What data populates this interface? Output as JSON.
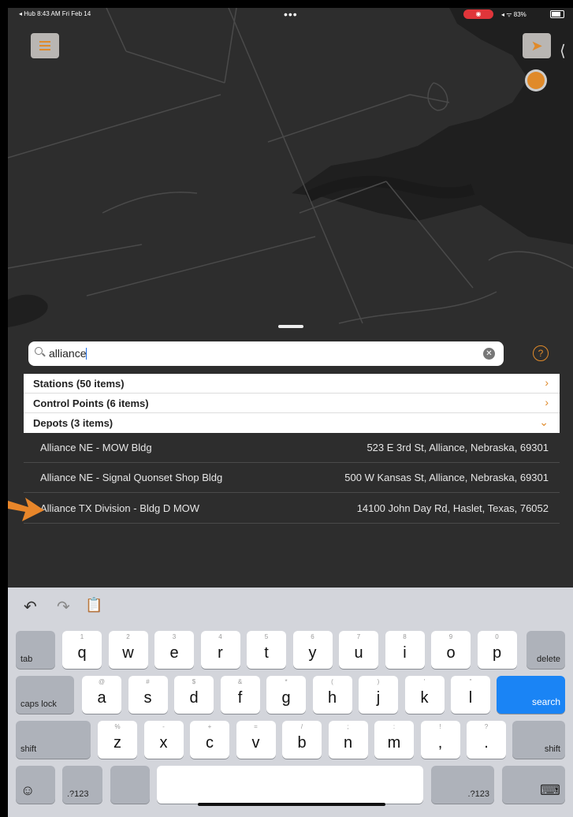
{
  "status_bar": {
    "left": "◂ Hub  8:43 AM  Fri Feb 14",
    "dots": "•••",
    "record": "◉",
    "right": "◂ ᯤ 83%"
  },
  "search": {
    "value": "alliance",
    "clear_label": "✕",
    "help_label": "?"
  },
  "categories": [
    {
      "label": "Stations  (50 items)",
      "chevron": "›",
      "expanded": false
    },
    {
      "label": "Control Points  (6 items)",
      "chevron": "›",
      "expanded": false
    },
    {
      "label": "Depots  (3 items)",
      "chevron": "⌄",
      "expanded": true
    }
  ],
  "results": [
    {
      "name": "Alliance NE - MOW Bldg",
      "address": "523 E 3rd St, Alliance, Nebraska, 69301"
    },
    {
      "name": "Alliance NE - Signal Quonset Shop Bldg",
      "address": "500 W Kansas St, Alliance, Nebraska, 69301"
    },
    {
      "name": "Alliance TX Division - Bldg D MOW",
      "address": "14100 John Day Rd, Haslet, Texas, 76052"
    }
  ],
  "keyboard": {
    "toolbar": {
      "undo": "↶",
      "redo": "↷",
      "paste": "📋"
    },
    "row1": {
      "tab": "tab",
      "keys": [
        [
          "1",
          "q"
        ],
        [
          "2",
          "w"
        ],
        [
          "3",
          "e"
        ],
        [
          "4",
          "r"
        ],
        [
          "5",
          "t"
        ],
        [
          "6",
          "y"
        ],
        [
          "7",
          "u"
        ],
        [
          "8",
          "i"
        ],
        [
          "9",
          "o"
        ],
        [
          "0",
          "p"
        ]
      ],
      "delete": "delete"
    },
    "row2": {
      "caps": "caps lock",
      "keys": [
        [
          "@",
          "a"
        ],
        [
          "#",
          "s"
        ],
        [
          "$",
          "d"
        ],
        [
          "&",
          "f"
        ],
        [
          "*",
          "g"
        ],
        [
          "(",
          "h"
        ],
        [
          ")",
          "j"
        ],
        [
          "'",
          "k"
        ],
        [
          "\"",
          "l"
        ]
      ],
      "search": "search"
    },
    "row3": {
      "shift_left": "shift",
      "keys": [
        [
          "%",
          "z"
        ],
        [
          "-",
          "x"
        ],
        [
          "+",
          "c"
        ],
        [
          "=",
          "v"
        ],
        [
          "/",
          "b"
        ],
        [
          ";",
          "n"
        ],
        [
          ":",
          "m"
        ],
        [
          "!",
          ","
        ],
        [
          "?",
          "."
        ]
      ],
      "shift_right": "shift"
    },
    "row4": {
      "emoji": "☺",
      "num_left": ".?123",
      "num_right": ".?123",
      "dismiss": "⌨"
    }
  },
  "colors": {
    "accent": "#e08a2a",
    "search_key": "#1a84f5",
    "map_bg": "#2b2b2b"
  }
}
